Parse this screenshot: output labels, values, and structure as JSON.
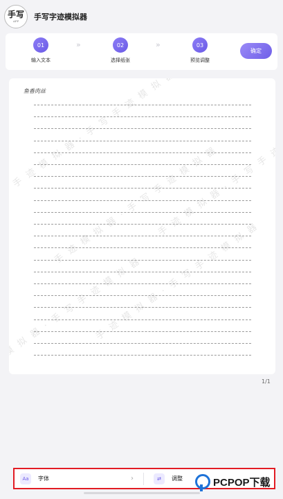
{
  "header": {
    "logo_main": "手写",
    "logo_sub": "APP",
    "title": "手写字迹模拟器"
  },
  "steps": [
    {
      "num": "01",
      "label": "输入文本"
    },
    {
      "num": "02",
      "label": "选择纸张"
    },
    {
      "num": "03",
      "label": "预览调整"
    }
  ],
  "step_separator": "»",
  "confirm_label": "确定",
  "paper": {
    "sample_text": "鱼香肉丝",
    "watermark": "手迹模拟器·手写手迹模拟器"
  },
  "page_count": "1/1",
  "toolbar": {
    "font_icon": "Aa",
    "font_label": "字体",
    "font_chevron": "›",
    "adjust_icon": "⇄",
    "adjust_label": "调整"
  },
  "brand": {
    "text": "PCPOP下载"
  },
  "colors": {
    "accent": "#6b5be6",
    "highlight_border": "#e21b23",
    "brand_blue": "#1e73d8"
  }
}
